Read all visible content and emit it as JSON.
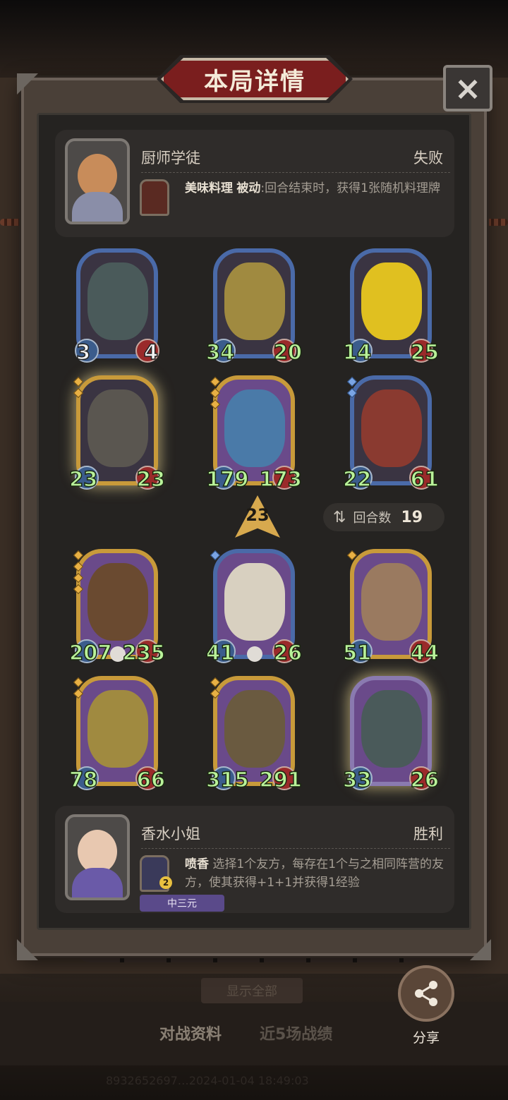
{
  "modal": {
    "title": "本局详情",
    "close_icon": "×"
  },
  "top_player": {
    "name": "厨师学徒",
    "result": "失败",
    "skill_name": "美味料理",
    "skill_type": "被动",
    "skill_desc": ":回合结束时，获得1张随机料理牌"
  },
  "bottom_player": {
    "name": "香水小姐",
    "result": "胜利",
    "skill_name": "喷香",
    "skill_desc": "选择1个友方，每存在1个与之相同阵营的友方，使其获得+1+1并获得1经验",
    "skill_badge": "2",
    "rank": "中三元"
  },
  "top_board": [
    {
      "atk": "3",
      "hp": "4"
    },
    {
      "atk": "34",
      "hp": "20"
    },
    {
      "atk": "14",
      "hp": "25"
    },
    {
      "atk": "23",
      "hp": "23"
    },
    {
      "atk": "179",
      "hp": "173"
    },
    {
      "atk": "22",
      "hp": "61"
    }
  ],
  "bottom_board": [
    {
      "atk": "207",
      "hp": "235"
    },
    {
      "atk": "41",
      "hp": "26"
    },
    {
      "atk": "51",
      "hp": "44"
    },
    {
      "atk": "78",
      "hp": "66"
    },
    {
      "atk": "315",
      "hp": "291"
    },
    {
      "atk": "33",
      "hp": "26"
    }
  ],
  "level": "23",
  "rounds": {
    "label": "回合数",
    "value": "19"
  },
  "background": {
    "show_all": "显示全部",
    "tab_battle": "对战资料",
    "tab_recent": "近5场战绩",
    "footer": "8932652697…2024-01-04 18:49:03"
  },
  "share": {
    "label": "分享"
  },
  "colors": {
    "accent_red": "#7a1e1e",
    "stat_green": "#b9f29a",
    "frame_gold": "#c89a3a",
    "frame_blue": "#4a6aa8"
  }
}
